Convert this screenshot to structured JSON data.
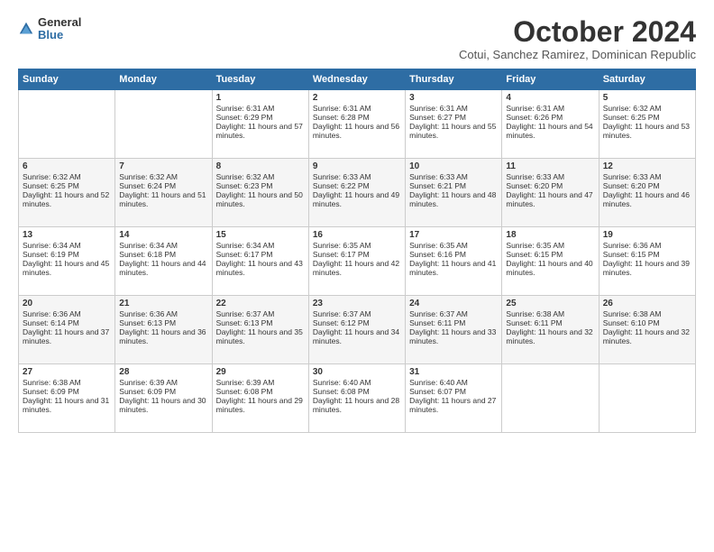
{
  "logo": {
    "general": "General",
    "blue": "Blue"
  },
  "header": {
    "month": "October 2024",
    "location": "Cotui, Sanchez Ramirez, Dominican Republic"
  },
  "days_of_week": [
    "Sunday",
    "Monday",
    "Tuesday",
    "Wednesday",
    "Thursday",
    "Friday",
    "Saturday"
  ],
  "weeks": [
    [
      {
        "day": "",
        "info": ""
      },
      {
        "day": "",
        "info": ""
      },
      {
        "day": "1",
        "sunrise": "6:31 AM",
        "sunset": "6:29 PM",
        "daylight": "11 hours and 57 minutes."
      },
      {
        "day": "2",
        "sunrise": "6:31 AM",
        "sunset": "6:28 PM",
        "daylight": "11 hours and 56 minutes."
      },
      {
        "day": "3",
        "sunrise": "6:31 AM",
        "sunset": "6:27 PM",
        "daylight": "11 hours and 55 minutes."
      },
      {
        "day": "4",
        "sunrise": "6:31 AM",
        "sunset": "6:26 PM",
        "daylight": "11 hours and 54 minutes."
      },
      {
        "day": "5",
        "sunrise": "6:32 AM",
        "sunset": "6:25 PM",
        "daylight": "11 hours and 53 minutes."
      }
    ],
    [
      {
        "day": "6",
        "sunrise": "6:32 AM",
        "sunset": "6:25 PM",
        "daylight": "11 hours and 52 minutes."
      },
      {
        "day": "7",
        "sunrise": "6:32 AM",
        "sunset": "6:24 PM",
        "daylight": "11 hours and 51 minutes."
      },
      {
        "day": "8",
        "sunrise": "6:32 AM",
        "sunset": "6:23 PM",
        "daylight": "11 hours and 50 minutes."
      },
      {
        "day": "9",
        "sunrise": "6:33 AM",
        "sunset": "6:22 PM",
        "daylight": "11 hours and 49 minutes."
      },
      {
        "day": "10",
        "sunrise": "6:33 AM",
        "sunset": "6:21 PM",
        "daylight": "11 hours and 48 minutes."
      },
      {
        "day": "11",
        "sunrise": "6:33 AM",
        "sunset": "6:20 PM",
        "daylight": "11 hours and 47 minutes."
      },
      {
        "day": "12",
        "sunrise": "6:33 AM",
        "sunset": "6:20 PM",
        "daylight": "11 hours and 46 minutes."
      }
    ],
    [
      {
        "day": "13",
        "sunrise": "6:34 AM",
        "sunset": "6:19 PM",
        "daylight": "11 hours and 45 minutes."
      },
      {
        "day": "14",
        "sunrise": "6:34 AM",
        "sunset": "6:18 PM",
        "daylight": "11 hours and 44 minutes."
      },
      {
        "day": "15",
        "sunrise": "6:34 AM",
        "sunset": "6:17 PM",
        "daylight": "11 hours and 43 minutes."
      },
      {
        "day": "16",
        "sunrise": "6:35 AM",
        "sunset": "6:17 PM",
        "daylight": "11 hours and 42 minutes."
      },
      {
        "day": "17",
        "sunrise": "6:35 AM",
        "sunset": "6:16 PM",
        "daylight": "11 hours and 41 minutes."
      },
      {
        "day": "18",
        "sunrise": "6:35 AM",
        "sunset": "6:15 PM",
        "daylight": "11 hours and 40 minutes."
      },
      {
        "day": "19",
        "sunrise": "6:36 AM",
        "sunset": "6:15 PM",
        "daylight": "11 hours and 39 minutes."
      }
    ],
    [
      {
        "day": "20",
        "sunrise": "6:36 AM",
        "sunset": "6:14 PM",
        "daylight": "11 hours and 37 minutes."
      },
      {
        "day": "21",
        "sunrise": "6:36 AM",
        "sunset": "6:13 PM",
        "daylight": "11 hours and 36 minutes."
      },
      {
        "day": "22",
        "sunrise": "6:37 AM",
        "sunset": "6:13 PM",
        "daylight": "11 hours and 35 minutes."
      },
      {
        "day": "23",
        "sunrise": "6:37 AM",
        "sunset": "6:12 PM",
        "daylight": "11 hours and 34 minutes."
      },
      {
        "day": "24",
        "sunrise": "6:37 AM",
        "sunset": "6:11 PM",
        "daylight": "11 hours and 33 minutes."
      },
      {
        "day": "25",
        "sunrise": "6:38 AM",
        "sunset": "6:11 PM",
        "daylight": "11 hours and 32 minutes."
      },
      {
        "day": "26",
        "sunrise": "6:38 AM",
        "sunset": "6:10 PM",
        "daylight": "11 hours and 32 minutes."
      }
    ],
    [
      {
        "day": "27",
        "sunrise": "6:38 AM",
        "sunset": "6:09 PM",
        "daylight": "11 hours and 31 minutes."
      },
      {
        "day": "28",
        "sunrise": "6:39 AM",
        "sunset": "6:09 PM",
        "daylight": "11 hours and 30 minutes."
      },
      {
        "day": "29",
        "sunrise": "6:39 AM",
        "sunset": "6:08 PM",
        "daylight": "11 hours and 29 minutes."
      },
      {
        "day": "30",
        "sunrise": "6:40 AM",
        "sunset": "6:08 PM",
        "daylight": "11 hours and 28 minutes."
      },
      {
        "day": "31",
        "sunrise": "6:40 AM",
        "sunset": "6:07 PM",
        "daylight": "11 hours and 27 minutes."
      },
      {
        "day": "",
        "info": ""
      },
      {
        "day": "",
        "info": ""
      }
    ]
  ]
}
